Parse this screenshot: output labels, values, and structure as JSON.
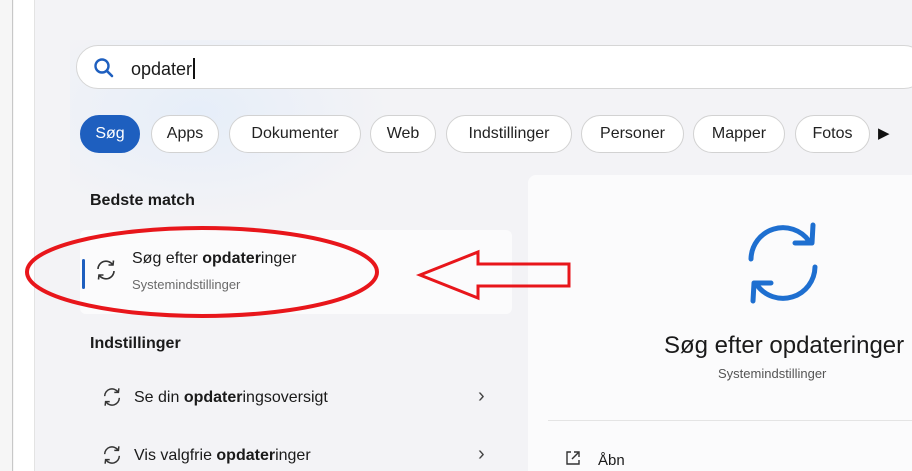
{
  "search": {
    "query": "opdater",
    "icon": "search-icon"
  },
  "filters": [
    {
      "label": "Søg",
      "active": true
    },
    {
      "label": "Apps",
      "active": false
    },
    {
      "label": "Dokumenter",
      "active": false
    },
    {
      "label": "Web",
      "active": false
    },
    {
      "label": "Indstillinger",
      "active": false
    },
    {
      "label": "Personer",
      "active": false
    },
    {
      "label": "Mapper",
      "active": false
    },
    {
      "label": "Fotos",
      "active": false
    }
  ],
  "filters_more_glyph": "▶",
  "best_match": {
    "heading": "Bedste match",
    "title_prefix": "Søg efter ",
    "title_bold": "opdater",
    "title_suffix": "inger",
    "subtitle": "Systemindstillinger",
    "icon": "refresh-icon"
  },
  "settings_section": {
    "heading": "Indstillinger",
    "items": [
      {
        "prefix": "Se din ",
        "bold": "opdater",
        "suffix": "ingsoversigt",
        "icon": "refresh-icon"
      },
      {
        "prefix": "Vis valgfrie ",
        "bold": "opdater",
        "suffix": "inger",
        "icon": "refresh-icon"
      }
    ]
  },
  "detail": {
    "title": "Søg efter opdateringer",
    "subtitle": "Systemindstillinger",
    "icon": "refresh-icon",
    "actions": [
      {
        "label": "Åbn",
        "icon": "open-external-icon"
      }
    ]
  },
  "colors": {
    "accent": "#1e5fbf",
    "annotation": "#e8161b"
  }
}
